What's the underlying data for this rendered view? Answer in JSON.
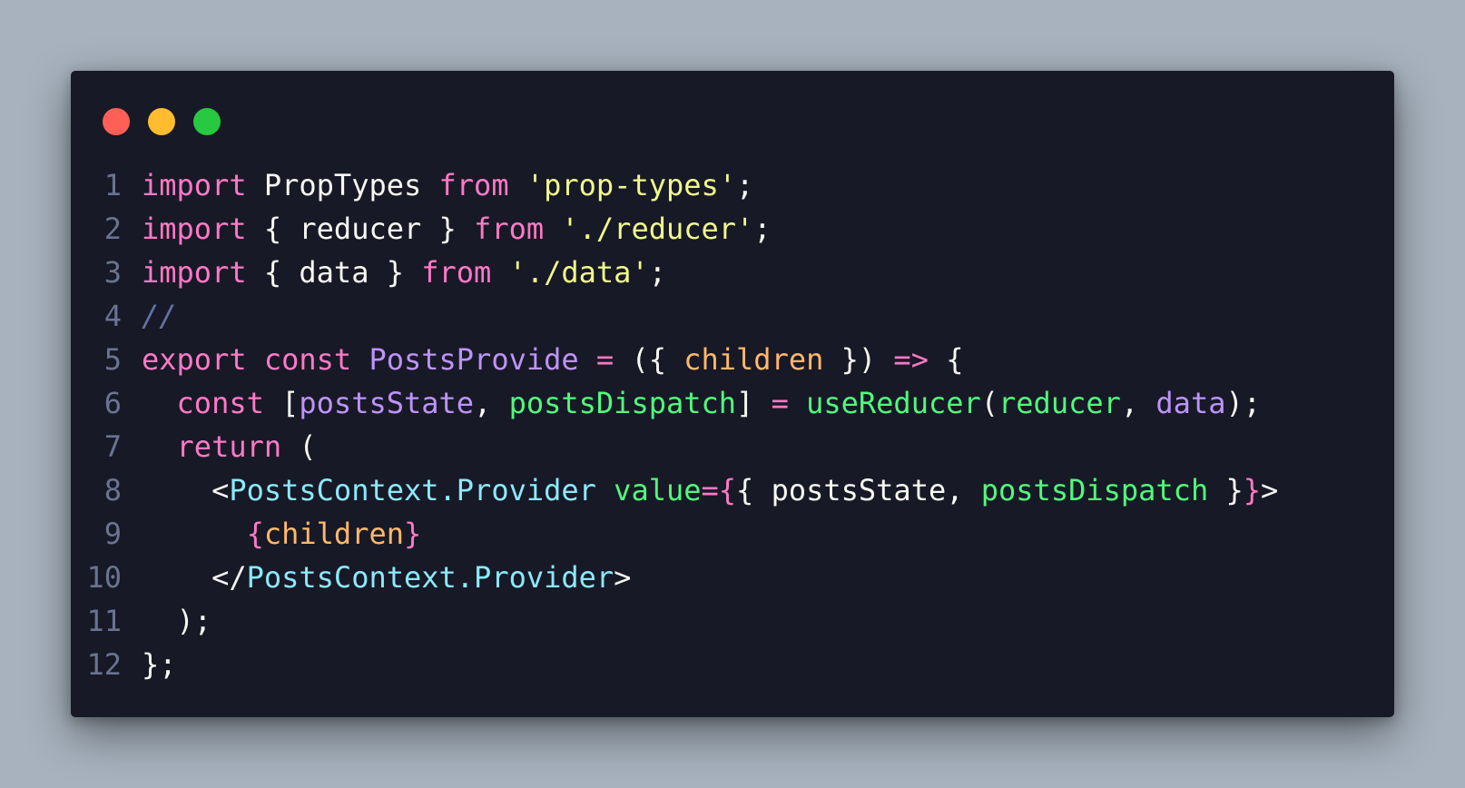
{
  "window": {
    "controls": [
      {
        "name": "close-dot",
        "color": "#fe5f57"
      },
      {
        "name": "minimize-dot",
        "color": "#febc2e"
      },
      {
        "name": "maximize-dot",
        "color": "#28c840"
      }
    ]
  },
  "colors": {
    "keyword": "#ff79c6",
    "string": "#f1fa8c",
    "comment": "#6272a4",
    "entity": "#bd93f9",
    "param": "#ffb86c",
    "function": "#50fa7b",
    "tag": "#8be9fd",
    "text": "#f8f8f2"
  },
  "code": {
    "lines": [
      {
        "n": "1",
        "tokens": [
          {
            "t": "import",
            "c": "keyword"
          },
          {
            "t": " PropTypes ",
            "c": "text"
          },
          {
            "t": "from",
            "c": "keyword"
          },
          {
            "t": " ",
            "c": "text"
          },
          {
            "t": "'prop-types'",
            "c": "string"
          },
          {
            "t": ";",
            "c": "text"
          }
        ]
      },
      {
        "n": "2",
        "tokens": [
          {
            "t": "import",
            "c": "keyword"
          },
          {
            "t": " { reducer } ",
            "c": "text"
          },
          {
            "t": "from",
            "c": "keyword"
          },
          {
            "t": " ",
            "c": "text"
          },
          {
            "t": "'./reducer'",
            "c": "string"
          },
          {
            "t": ";",
            "c": "text"
          }
        ]
      },
      {
        "n": "3",
        "tokens": [
          {
            "t": "import",
            "c": "keyword"
          },
          {
            "t": " { data } ",
            "c": "text"
          },
          {
            "t": "from",
            "c": "keyword"
          },
          {
            "t": " ",
            "c": "text"
          },
          {
            "t": "'./data'",
            "c": "string"
          },
          {
            "t": ";",
            "c": "text"
          }
        ]
      },
      {
        "n": "4",
        "tokens": [
          {
            "t": "//",
            "c": "comment"
          }
        ]
      },
      {
        "n": "5",
        "tokens": [
          {
            "t": "export",
            "c": "keyword"
          },
          {
            "t": " ",
            "c": "text"
          },
          {
            "t": "const",
            "c": "keyword"
          },
          {
            "t": " ",
            "c": "text"
          },
          {
            "t": "PostsProvide",
            "c": "entity"
          },
          {
            "t": " ",
            "c": "text"
          },
          {
            "t": "=",
            "c": "keyword"
          },
          {
            "t": " ({ ",
            "c": "text"
          },
          {
            "t": "children",
            "c": "param"
          },
          {
            "t": " }) ",
            "c": "text"
          },
          {
            "t": "=>",
            "c": "keyword"
          },
          {
            "t": " {",
            "c": "text"
          }
        ]
      },
      {
        "n": "6",
        "tokens": [
          {
            "t": "  ",
            "c": "text"
          },
          {
            "t": "const",
            "c": "keyword"
          },
          {
            "t": " [",
            "c": "text"
          },
          {
            "t": "postsState",
            "c": "entity"
          },
          {
            "t": ", ",
            "c": "text"
          },
          {
            "t": "postsDispatch",
            "c": "function"
          },
          {
            "t": "] ",
            "c": "text"
          },
          {
            "t": "=",
            "c": "keyword"
          },
          {
            "t": " ",
            "c": "text"
          },
          {
            "t": "useReducer",
            "c": "function"
          },
          {
            "t": "(",
            "c": "text"
          },
          {
            "t": "reducer",
            "c": "function"
          },
          {
            "t": ", ",
            "c": "text"
          },
          {
            "t": "data",
            "c": "entity"
          },
          {
            "t": ");",
            "c": "text"
          }
        ]
      },
      {
        "n": "7",
        "tokens": [
          {
            "t": "  ",
            "c": "text"
          },
          {
            "t": "return",
            "c": "keyword"
          },
          {
            "t": " (",
            "c": "text"
          }
        ]
      },
      {
        "n": "8",
        "tokens": [
          {
            "t": "    <",
            "c": "text"
          },
          {
            "t": "PostsContext.Provider",
            "c": "tag"
          },
          {
            "t": " ",
            "c": "text"
          },
          {
            "t": "value",
            "c": "function"
          },
          {
            "t": "=",
            "c": "keyword"
          },
          {
            "t": "{",
            "c": "keyword"
          },
          {
            "t": "{ postsState, ",
            "c": "text"
          },
          {
            "t": "postsDispatch",
            "c": "function"
          },
          {
            "t": " }",
            "c": "text"
          },
          {
            "t": "}",
            "c": "keyword"
          },
          {
            "t": ">",
            "c": "text"
          }
        ]
      },
      {
        "n": "9",
        "tokens": [
          {
            "t": "      ",
            "c": "text"
          },
          {
            "t": "{",
            "c": "keyword"
          },
          {
            "t": "children",
            "c": "param"
          },
          {
            "t": "}",
            "c": "keyword"
          }
        ]
      },
      {
        "n": "10",
        "tokens": [
          {
            "t": "    </",
            "c": "text"
          },
          {
            "t": "PostsContext.Provider",
            "c": "tag"
          },
          {
            "t": ">",
            "c": "text"
          }
        ]
      },
      {
        "n": "11",
        "tokens": [
          {
            "t": "  );",
            "c": "text"
          }
        ]
      },
      {
        "n": "12",
        "tokens": [
          {
            "t": "};",
            "c": "text"
          }
        ]
      }
    ]
  }
}
